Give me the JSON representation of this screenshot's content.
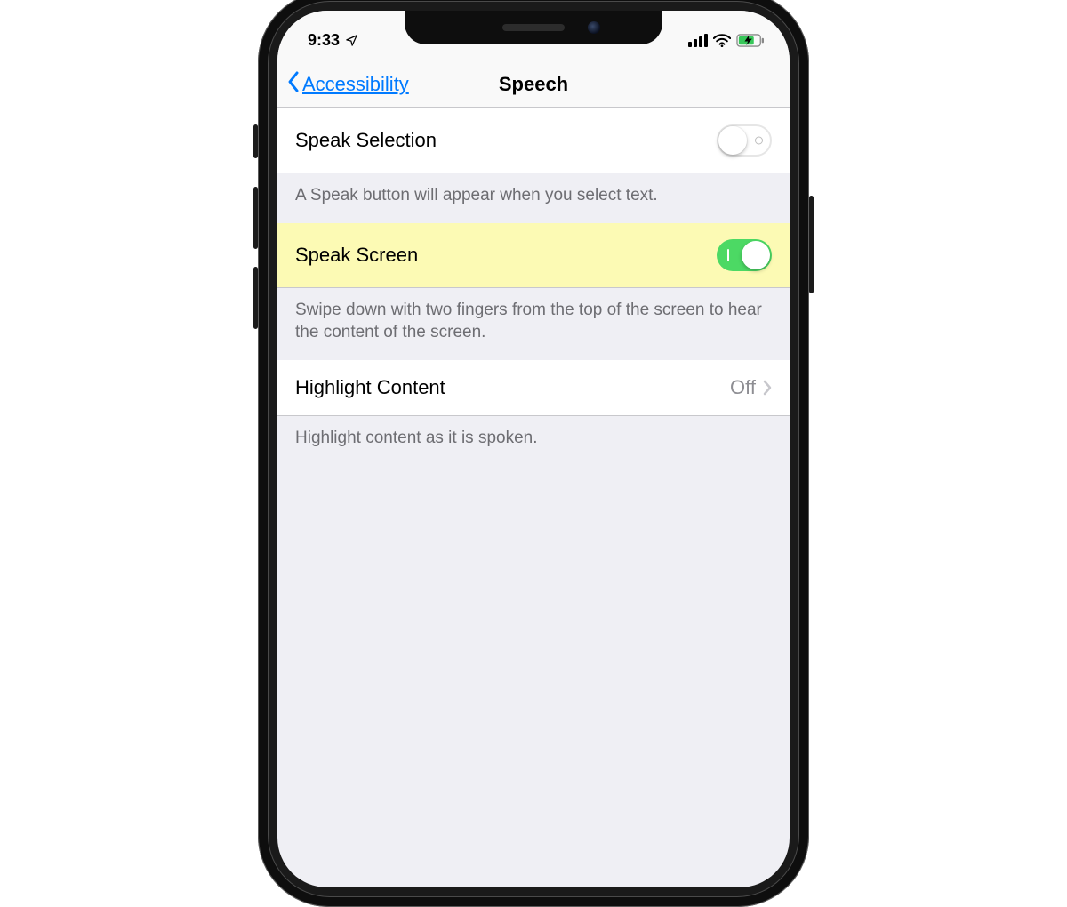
{
  "status": {
    "time": "9:33"
  },
  "nav": {
    "back_label": "Accessibility",
    "title": "Speech"
  },
  "rows": {
    "speak_selection": {
      "label": "Speak Selection",
      "enabled": false,
      "footer": "A Speak button will appear when you select text."
    },
    "speak_screen": {
      "label": "Speak Screen",
      "enabled": true,
      "footer": "Swipe down with two fingers from the top of the screen to hear the content of the screen."
    },
    "highlight_content": {
      "label": "Highlight Content",
      "value": "Off",
      "footer": "Highlight content as it is spoken."
    }
  },
  "colors": {
    "tint": "#007aff",
    "switch_on": "#4cd964",
    "highlight_row": "#fcfab4"
  }
}
